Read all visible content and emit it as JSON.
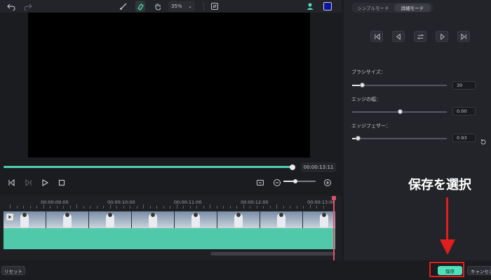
{
  "toolbar": {
    "zoom_value": "35%",
    "color_swatch": "#0a14a8"
  },
  "player": {
    "timecode": "00:00:13:11",
    "progress": 1.0,
    "volume": 0.35
  },
  "timeline": {
    "ruler_labels": [
      "00:00:09:00",
      "00:00:10:00",
      "00:00:11:00",
      "00:00:12:00",
      "00:00:13:00"
    ],
    "clip_count": 8,
    "track_color": "#4fc9a9"
  },
  "panel": {
    "tabs": [
      "シンプルモード",
      "詳細モード"
    ],
    "active_tab": "詳細モード",
    "brush": {
      "label": "ブラシサイズ：",
      "value": "30",
      "level": 0.1
    },
    "edge_width": {
      "label": "エッジの幅：",
      "value": "0.00",
      "level": 0.5
    },
    "edge_feather": {
      "label": "エッジフェザー：",
      "value": "0.93",
      "level": 0.06
    }
  },
  "footer": {
    "reset": "リセット",
    "save": "保存",
    "cancel": "キャンセル"
  },
  "annotation": {
    "text": "保存を選択",
    "color": "#e11d1d"
  },
  "colors": {
    "accent": "#4ee0b8"
  }
}
